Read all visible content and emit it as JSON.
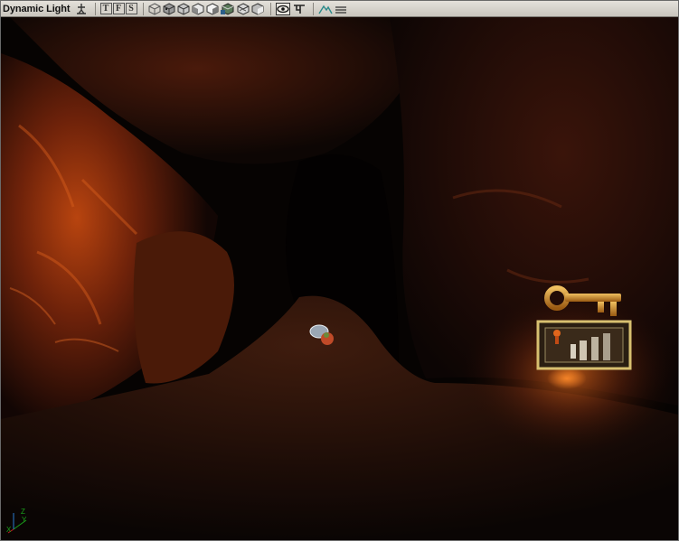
{
  "window": {
    "title": "Dynamic Light"
  },
  "toolbar": {
    "view_mode_buttons": [
      "T",
      "F",
      "S"
    ],
    "icons": [
      "actor-pin-icon",
      "wireframe-cube-icon",
      "zone-cube-icon",
      "brush-cube-icon",
      "unlit-cube-icon",
      "lit-cube-icon",
      "textured-cube-icon",
      "dynamic-light-cube-icon",
      "lighting-cube-icon",
      "realtime-eye-icon",
      "lock-icon",
      "terrain-mountain-icon",
      "menu-icon"
    ]
  },
  "viewport": {
    "axis_labels": [
      "Z",
      "Y",
      "X"
    ]
  },
  "colors": {
    "toolbar_bg": "#d4d0c8",
    "cave_rock": "#7a2a0a",
    "cave_highlight": "#d45a18",
    "key_gold": "#c8892a"
  }
}
